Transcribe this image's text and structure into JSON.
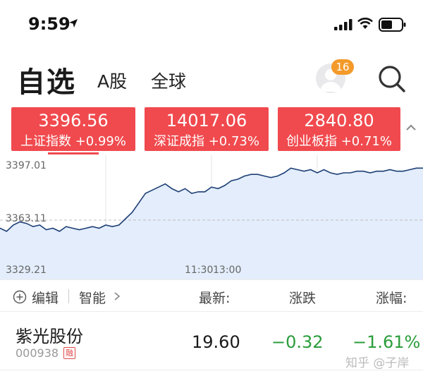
{
  "status_bar": {
    "time": "9:59",
    "icons": [
      "location-arrow-icon",
      "signal-icon",
      "wifi-icon",
      "battery-icon"
    ]
  },
  "header": {
    "title": "自选",
    "tabs": [
      {
        "label": "A股"
      },
      {
        "label": "全球"
      }
    ],
    "notification_count": "16",
    "icons": [
      "avatar-icon",
      "search-icon"
    ]
  },
  "indices": [
    {
      "value": "3396.56",
      "label": "上证指数 +0.99%"
    },
    {
      "value": "14017.06",
      "label": "深证成指 +0.73%"
    },
    {
      "value": "2840.80",
      "label": "创业板指 +0.71%"
    }
  ],
  "chart_data": {
    "type": "area",
    "y_labels": [
      "3397.01",
      "3363.11",
      "3329.21"
    ],
    "x_labels": [
      "11:30",
      "13:00"
    ],
    "ylim": [
      3329.21,
      3397.01
    ],
    "reference_line": 3363.11,
    "grid": true,
    "series": [
      {
        "values": [
          3358,
          3356,
          3360,
          3362,
          3361,
          3359,
          3360,
          3357,
          3358,
          3356,
          3359,
          3358,
          3357,
          3358,
          3359,
          3358,
          3360,
          3359,
          3360,
          3364,
          3368,
          3374,
          3380,
          3382,
          3384,
          3386,
          3383,
          3381,
          3383,
          3380,
          3381,
          3381,
          3384,
          3383,
          3385,
          3388,
          3389,
          3391,
          3392,
          3392,
          3391,
          3390,
          3391,
          3393,
          3396,
          3395,
          3394,
          3395,
          3393,
          3395,
          3393,
          3392,
          3393,
          3393,
          3394,
          3394,
          3393,
          3394,
          3394,
          3395,
          3394,
          3394,
          3395,
          3396,
          3396
        ]
      }
    ]
  },
  "list": {
    "edit_label": "编辑",
    "smart_label": "智能",
    "columns": {
      "latest": "最新:",
      "change": "涨跌",
      "pct": "涨幅:"
    },
    "rows": [
      {
        "name": "紫光股份",
        "code": "000938",
        "tag": "融",
        "price": "19.60",
        "change": "−0.32",
        "pct": "−1.61%"
      }
    ]
  },
  "watermark": "知乎 @子岸",
  "colors": {
    "up": "#f04a4e",
    "down": "#2a9d3a",
    "line": "#1d3f75",
    "area": "#e3edfb",
    "badge": "#f39a2a"
  }
}
